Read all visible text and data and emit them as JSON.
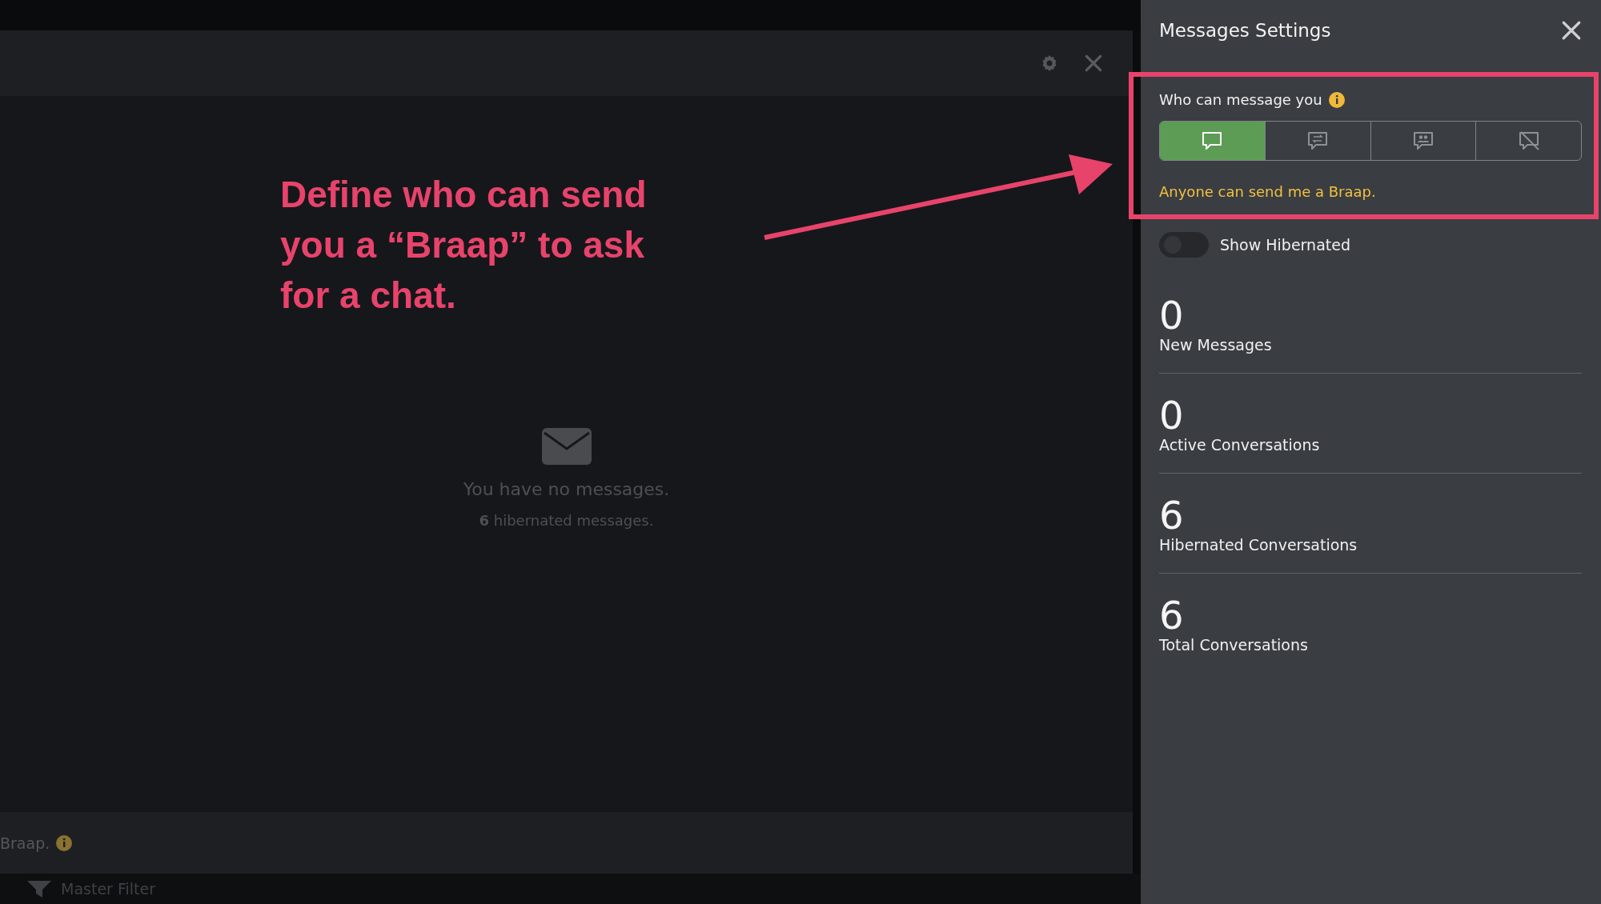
{
  "modal": {
    "empty_title": "You have no messages.",
    "hibernated_note": "**6** hibernated messages.",
    "footer_text": "Braap."
  },
  "bottom_bar": {
    "label": "Master Filter"
  },
  "annotation": {
    "text": "Define who can send you a “Braap” to ask for a chat."
  },
  "panel": {
    "title": "Messages Settings",
    "who_label": "Who can message you",
    "options": [
      {
        "kind": "anyone",
        "selected": true
      },
      {
        "kind": "exchange",
        "selected": false
      },
      {
        "kind": "group",
        "selected": false
      },
      {
        "kind": "nobody",
        "selected": false
      }
    ],
    "option_description": "Anyone can send me a Braap.",
    "toggle": {
      "label": "Show Hibernated",
      "on": false
    },
    "stats": [
      {
        "value": "0",
        "label": "New Messages"
      },
      {
        "value": "0",
        "label": "Active Conversations"
      },
      {
        "value": "6",
        "label": "Hibernated Conversations"
      },
      {
        "value": "6",
        "label": "Total Conversations"
      }
    ]
  }
}
